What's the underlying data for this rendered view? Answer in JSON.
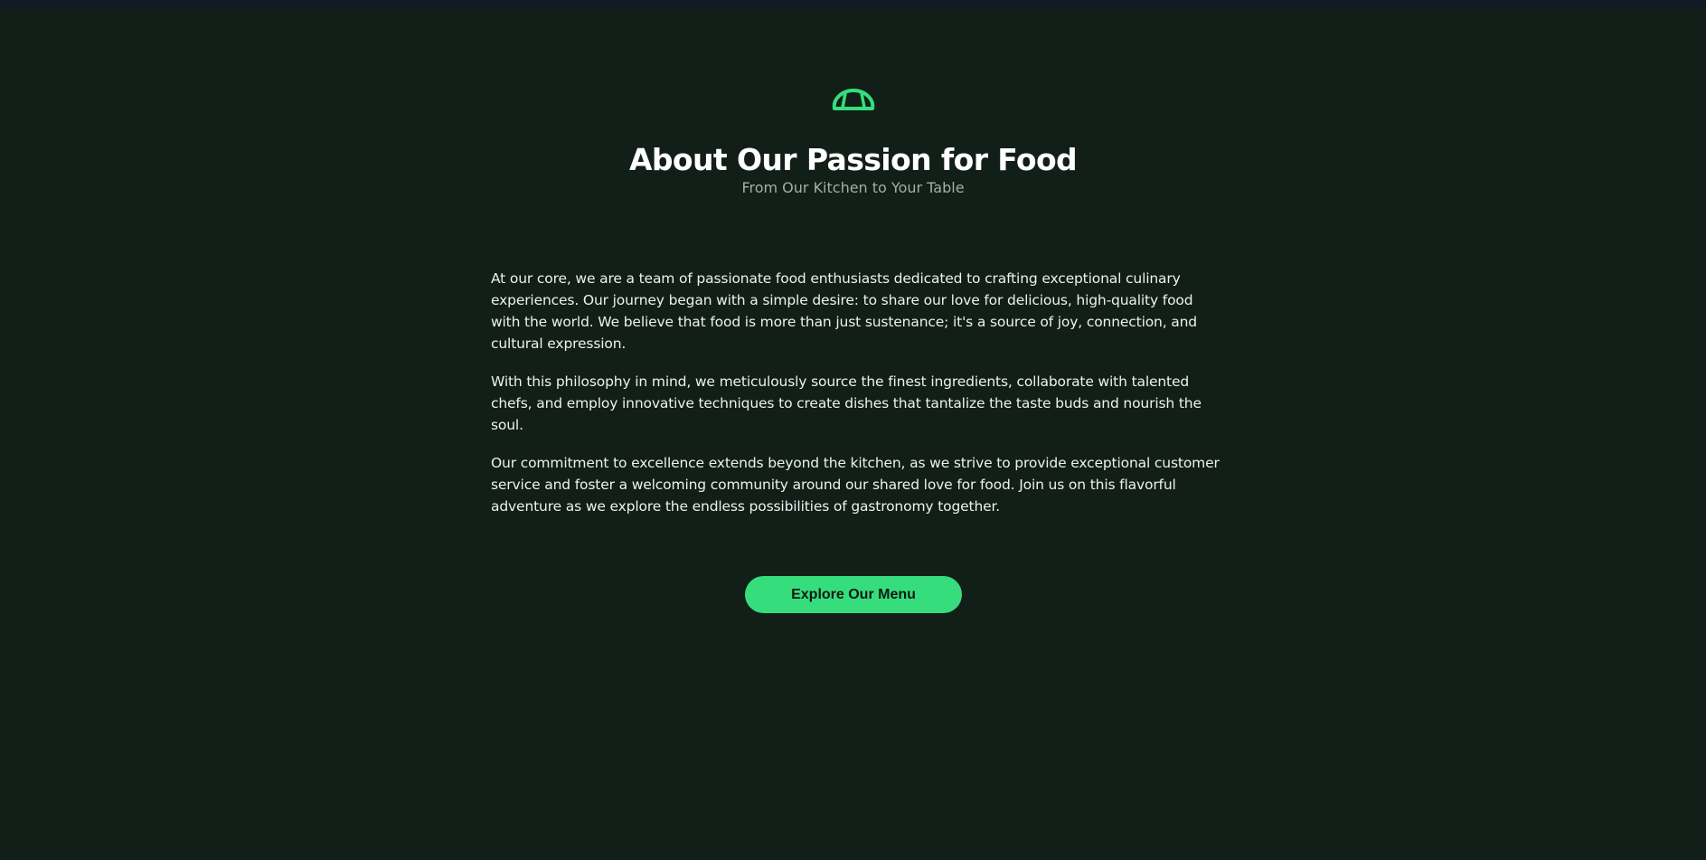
{
  "header": {
    "logo_icon": "croissant-icon",
    "title": "About Our Passion for Food",
    "subtitle": "From Our Kitchen to Your Table"
  },
  "about": {
    "paragraphs": [
      "At our core, we are a team of passionate food enthusiasts dedicated to crafting exceptional culinary experiences. Our journey began with a simple desire: to share our love for delicious, high-quality food with the world. We believe that food is more than just sustenance; it's a source of joy, connection, and cultural expression.",
      "With this philosophy in mind, we meticulously source the finest ingredients, collaborate with talented chefs, and employ innovative techniques to create dishes that tantalize the taste buds and nourish the soul.",
      "Our commitment to excellence extends beyond the kitchen, as we strive to provide exceptional customer service and foster a welcoming community around our shared love for food. Join us on this flavorful adventure as we explore the endless possibilities of gastronomy together."
    ]
  },
  "cta": {
    "label": "Explore Our Menu"
  },
  "colors": {
    "background": "#111f18",
    "accent": "#36dd7c",
    "top_strip": "#121a26",
    "title": "#ffffff",
    "subtitle": "#a5aeaa"
  }
}
